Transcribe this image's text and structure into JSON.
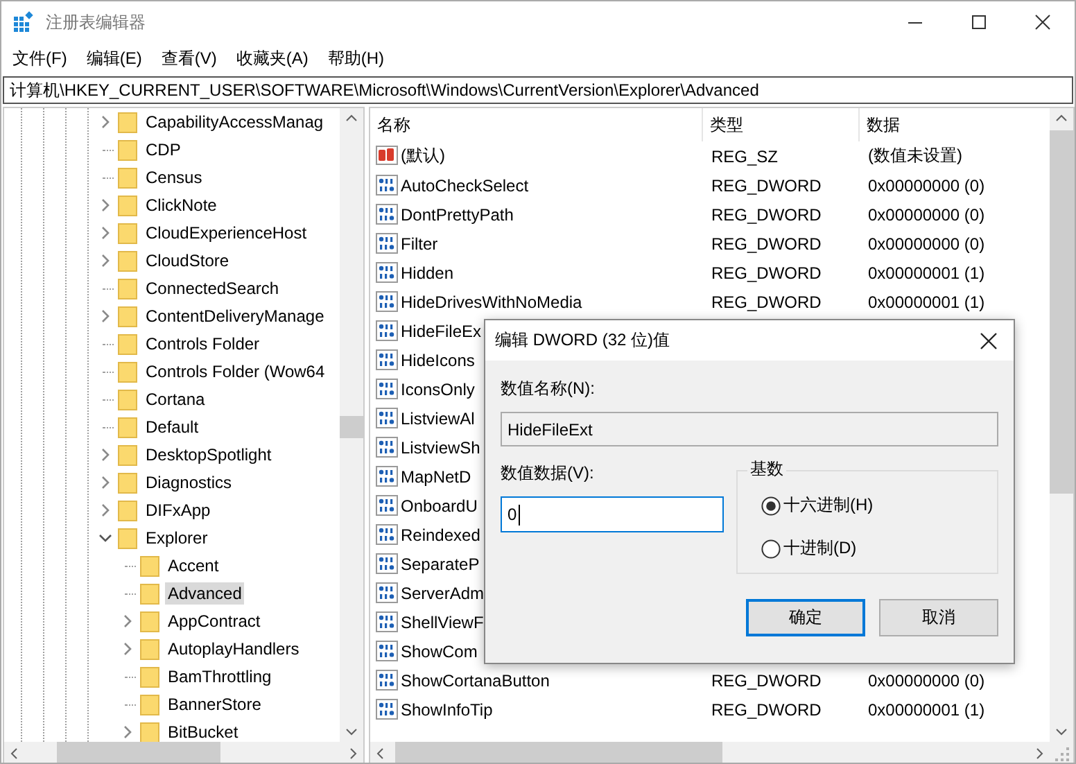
{
  "window": {
    "title": "注册表编辑器"
  },
  "menu": [
    "文件(F)",
    "编辑(E)",
    "查看(V)",
    "收藏夹(A)",
    "帮助(H)"
  ],
  "address": "计算机\\HKEY_CURRENT_USER\\SOFTWARE\\Microsoft\\Windows\\CurrentVersion\\Explorer\\Advanced",
  "tree": [
    {
      "label": "CapabilityAccessManag",
      "expandable": true,
      "expanded": false,
      "selected": false
    },
    {
      "label": "CDP",
      "expandable": false,
      "expanded": false,
      "selected": false
    },
    {
      "label": "Census",
      "expandable": false,
      "expanded": false,
      "selected": false
    },
    {
      "label": "ClickNote",
      "expandable": true,
      "expanded": false,
      "selected": false
    },
    {
      "label": "CloudExperienceHost",
      "expandable": true,
      "expanded": false,
      "selected": false
    },
    {
      "label": "CloudStore",
      "expandable": true,
      "expanded": false,
      "selected": false
    },
    {
      "label": "ConnectedSearch",
      "expandable": false,
      "expanded": false,
      "selected": false
    },
    {
      "label": "ContentDeliveryManage",
      "expandable": true,
      "expanded": false,
      "selected": false
    },
    {
      "label": "Controls Folder",
      "expandable": false,
      "expanded": false,
      "selected": false
    },
    {
      "label": "Controls Folder (Wow64",
      "expandable": false,
      "expanded": false,
      "selected": false
    },
    {
      "label": "Cortana",
      "expandable": false,
      "expanded": false,
      "selected": false
    },
    {
      "label": "Default",
      "expandable": false,
      "expanded": false,
      "selected": false
    },
    {
      "label": "DesktopSpotlight",
      "expandable": true,
      "expanded": false,
      "selected": false
    },
    {
      "label": "Diagnostics",
      "expandable": true,
      "expanded": false,
      "selected": false
    },
    {
      "label": "DIFxApp",
      "expandable": true,
      "expanded": false,
      "selected": false
    },
    {
      "label": "Explorer",
      "expandable": true,
      "expanded": true,
      "selected": false,
      "children": [
        {
          "label": "Accent",
          "expandable": false,
          "expanded": false,
          "selected": false
        },
        {
          "label": "Advanced",
          "expandable": false,
          "expanded": false,
          "selected": true
        },
        {
          "label": "AppContract",
          "expandable": true,
          "expanded": false,
          "selected": false
        },
        {
          "label": "AutoplayHandlers",
          "expandable": true,
          "expanded": false,
          "selected": false
        },
        {
          "label": "BamThrottling",
          "expandable": false,
          "expanded": false,
          "selected": false
        },
        {
          "label": "BannerStore",
          "expandable": false,
          "expanded": false,
          "selected": false
        },
        {
          "label": "BitBucket",
          "expandable": true,
          "expanded": false,
          "selected": false
        }
      ]
    }
  ],
  "table": {
    "columns": [
      "名称",
      "类型",
      "数据"
    ],
    "rows": [
      {
        "kind": "string",
        "name": "(默认)",
        "type": "REG_SZ",
        "data": "(数值未设置)"
      },
      {
        "kind": "dword",
        "name": "AutoCheckSelect",
        "type": "REG_DWORD",
        "data": "0x00000000 (0)"
      },
      {
        "kind": "dword",
        "name": "DontPrettyPath",
        "type": "REG_DWORD",
        "data": "0x00000000 (0)"
      },
      {
        "kind": "dword",
        "name": "Filter",
        "type": "REG_DWORD",
        "data": "0x00000000 (0)"
      },
      {
        "kind": "dword",
        "name": "Hidden",
        "type": "REG_DWORD",
        "data": "0x00000001 (1)"
      },
      {
        "kind": "dword",
        "name": "HideDrivesWithNoMedia",
        "type": "REG_DWORD",
        "data": "0x00000001 (1)"
      },
      {
        "kind": "dword",
        "name": "HideFileEx"
      },
      {
        "kind": "dword",
        "name": "HideIcons"
      },
      {
        "kind": "dword",
        "name": "IconsOnly"
      },
      {
        "kind": "dword",
        "name": "ListviewAl"
      },
      {
        "kind": "dword",
        "name": "ListviewSh"
      },
      {
        "kind": "dword",
        "name": "MapNetD"
      },
      {
        "kind": "dword",
        "name": "OnboardU"
      },
      {
        "kind": "dword",
        "name": "Reindexed"
      },
      {
        "kind": "dword",
        "name": "SeparateP"
      },
      {
        "kind": "dword",
        "name": "ServerAdm"
      },
      {
        "kind": "dword",
        "name": "ShellViewF"
      },
      {
        "kind": "dword",
        "name": "ShowCom"
      },
      {
        "kind": "dword",
        "name": "ShowCortanaButton",
        "type": "REG_DWORD",
        "data": "0x00000000 (0)"
      },
      {
        "kind": "dword",
        "name": "ShowInfoTip",
        "type": "REG_DWORD",
        "data": "0x00000001 (1)"
      }
    ]
  },
  "dialog": {
    "title": "编辑 DWORD (32 位)值",
    "name_label": "数值名称(N):",
    "name_value": "HideFileExt",
    "data_label": "数值数据(V):",
    "data_value": "0",
    "base_label": "基数",
    "radios": [
      {
        "label": "十六进制(H)",
        "selected": true
      },
      {
        "label": "十进制(D)",
        "selected": false
      }
    ],
    "buttons": [
      {
        "label": "确定",
        "default": true
      },
      {
        "label": "取消",
        "default": false
      }
    ]
  }
}
